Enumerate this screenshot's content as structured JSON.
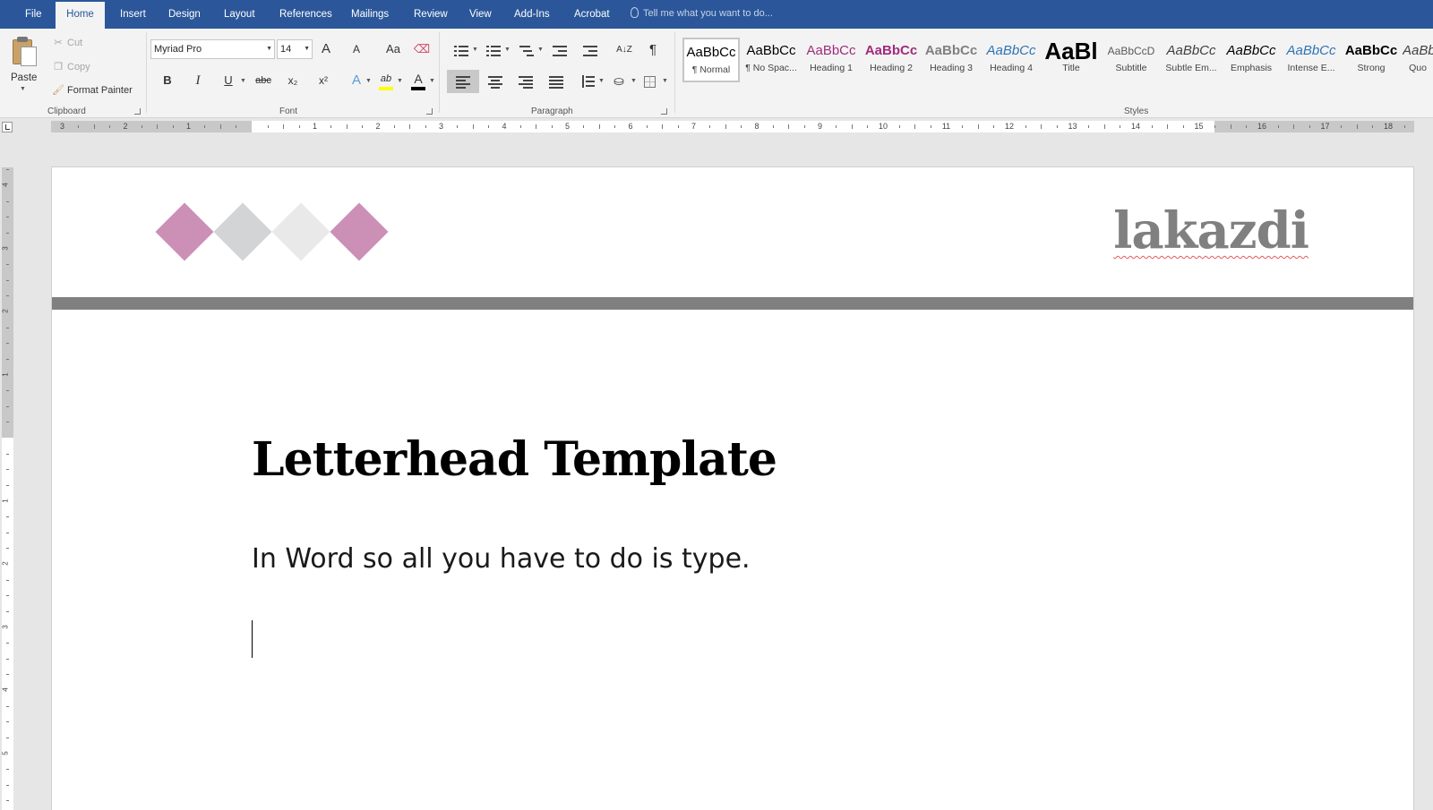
{
  "tabs": {
    "file": "File",
    "home": "Home",
    "insert": "Insert",
    "design": "Design",
    "layout": "Layout",
    "references": "References",
    "mailings": "Mailings",
    "review": "Review",
    "view": "View",
    "addins": "Add-Ins",
    "acrobat": "Acrobat"
  },
  "tell_me": {
    "placeholder": "Tell me what you want to do..."
  },
  "clipboard": {
    "group_label": "Clipboard",
    "paste": "Paste",
    "cut": "Cut",
    "copy": "Copy",
    "format_painter": "Format Painter"
  },
  "font": {
    "group_label": "Font",
    "name": "Myriad Pro",
    "size": "14",
    "grow": "A",
    "shrink": "A",
    "change_case": "Aa",
    "bold": "B",
    "italic": "I",
    "underline": "U",
    "strike": "abc",
    "subscript": "x₂",
    "superscript": "x²",
    "text_effects": "A",
    "highlight": "ab",
    "font_color": "A",
    "highlight_color": "#ffff00",
    "font_color_value": "#000000"
  },
  "paragraph": {
    "group_label": "Paragraph",
    "show_marks": "¶",
    "sort": "A↓Z"
  },
  "styles": {
    "group_label": "Styles",
    "items": [
      {
        "sample": "AaBbCc",
        "name": "¶ Normal",
        "color": "#000000"
      },
      {
        "sample": "AaBbCc",
        "name": "¶ No Spac...",
        "color": "#000000"
      },
      {
        "sample": "AaBbCc",
        "name": "Heading 1",
        "color": "#a02b7d"
      },
      {
        "sample": "AaBbCc",
        "name": "Heading 2",
        "color": "#a02b7d"
      },
      {
        "sample": "AaBbCc",
        "name": "Heading 3",
        "color": "#808080"
      },
      {
        "sample": "AaBbCc",
        "name": "Heading 4",
        "color": "#2e74b5"
      },
      {
        "sample": "AaBl",
        "name": "Title",
        "color": "#000000"
      },
      {
        "sample": "AaBbCcD",
        "name": "Subtitle",
        "color": "#595959"
      },
      {
        "sample": "AaBbCc",
        "name": "Subtle Em...",
        "color": "#404040"
      },
      {
        "sample": "AaBbCc",
        "name": "Emphasis",
        "color": "#000000"
      },
      {
        "sample": "AaBbCc",
        "name": "Intense E...",
        "color": "#2e74b5"
      },
      {
        "sample": "AaBbCc",
        "name": "Strong",
        "color": "#000000"
      },
      {
        "sample": "AaBb",
        "name": "Quo",
        "color": "#404040"
      }
    ]
  },
  "ruler": {
    "h_labels": [
      "3",
      "2",
      "1",
      "1",
      "2",
      "3",
      "4",
      "5",
      "6",
      "7",
      "8",
      "9",
      "10",
      "11",
      "12",
      "13",
      "14",
      "15",
      "16",
      "17",
      "18"
    ],
    "v_labels": [
      "4",
      "3",
      "2",
      "1",
      "1",
      "2",
      "3",
      "4",
      "5"
    ]
  },
  "document": {
    "logo": "lakazdi",
    "title": "Letterhead Template",
    "subtitle": "In Word so all you have to do is type.",
    "diamond_colors": [
      "#cc8fb5",
      "#d3d4d6",
      "#e9e9ea",
      "#cc8fb5"
    ],
    "rule_color": "#808080"
  },
  "colors": {
    "ribbon_blue": "#2b579a",
    "ribbon_bg": "#f3f3f3"
  }
}
